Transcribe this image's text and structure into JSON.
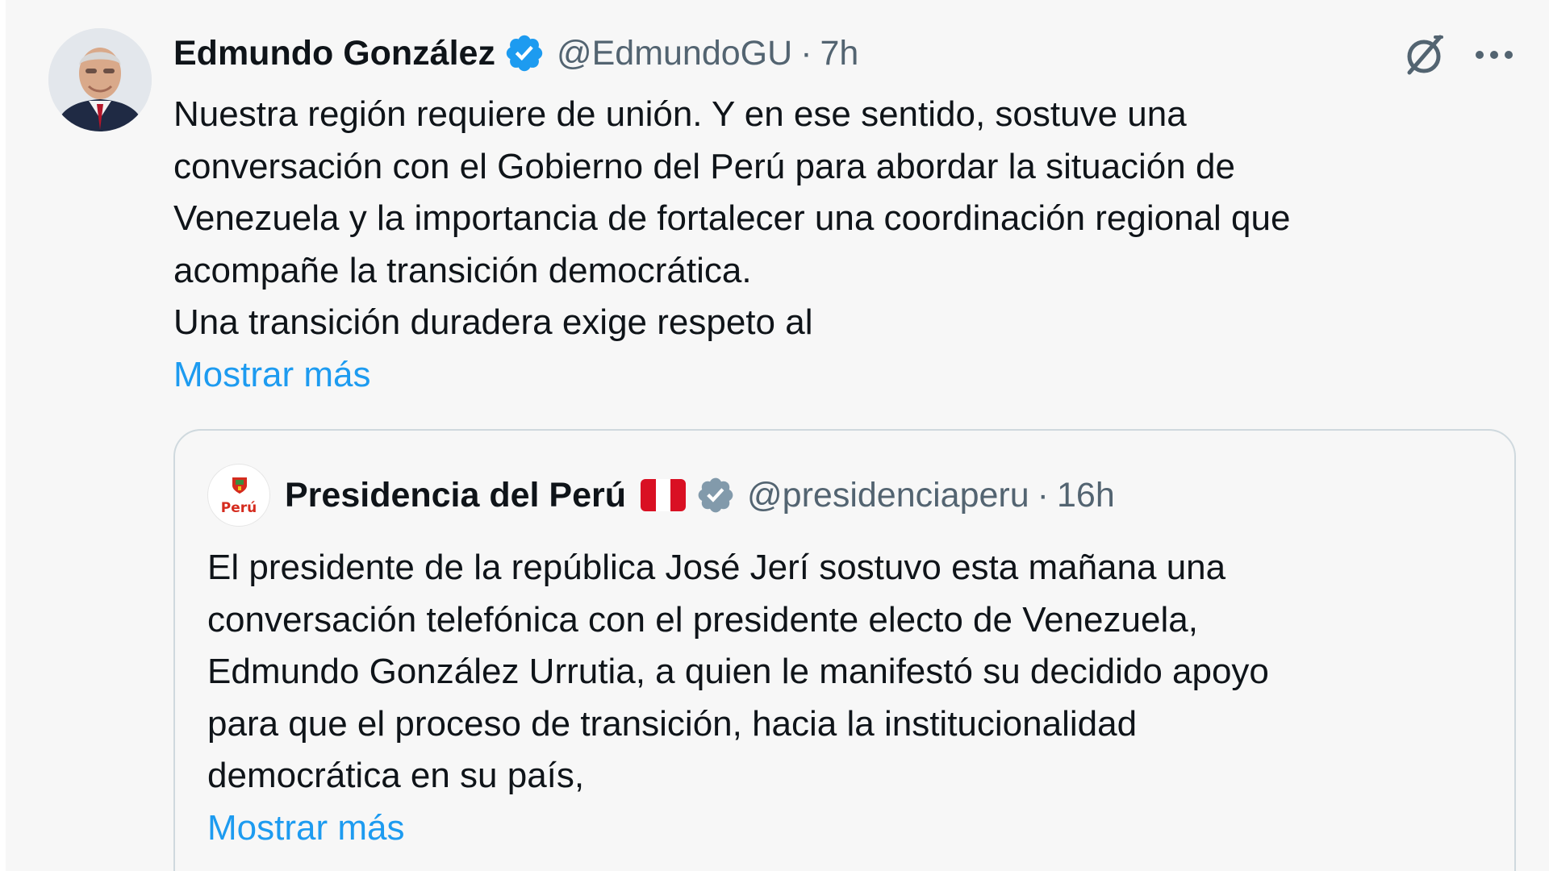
{
  "post": {
    "author_name": "Edmundo González",
    "handle": "@EdmundoGU",
    "separator": "·",
    "time": "7h",
    "verified_icon": "verified-badge-icon",
    "body_lines": [
      "Nuestra región requiere de unión. Y en ese sentido, sostuve una",
      "conversación con el Gobierno del Perú para abordar la situación de",
      "Venezuela y la importancia de fortalecer una coordinación regional que",
      "acompañe la transición democrática.",
      "Una transición duradera exige respeto al"
    ],
    "show_more": "Mostrar más"
  },
  "quote": {
    "avatar_text": "Perú",
    "author_name": "Presidencia del Perú",
    "flag_icon": "peru-flag-icon",
    "verified_icon": "gray-verified-badge-icon",
    "handle": "@presidenciaperu",
    "separator": "·",
    "time": "16h",
    "body_lines": [
      "El presidente de la república José Jerí sostuvo esta mañana una",
      "conversación telefónica con el presidente electo de Venezuela,",
      "Edmundo González Urrutia, a quien le manifestó su decidido apoyo",
      "para que el proceso de transición, hacia la institucionalidad",
      "democrática en su país,"
    ],
    "show_more": "Mostrar más"
  },
  "icons": {
    "grok": "grok-icon",
    "more": "more-options-icon"
  },
  "colors": {
    "background": "#f7f7f7",
    "text_primary": "#0f1419",
    "text_secondary": "#536471",
    "link": "#1d9bf0",
    "verified_blue": "#1d9bf0",
    "verified_gray": "#829aab",
    "border": "#cfd9de",
    "flag_red": "#d91023"
  }
}
